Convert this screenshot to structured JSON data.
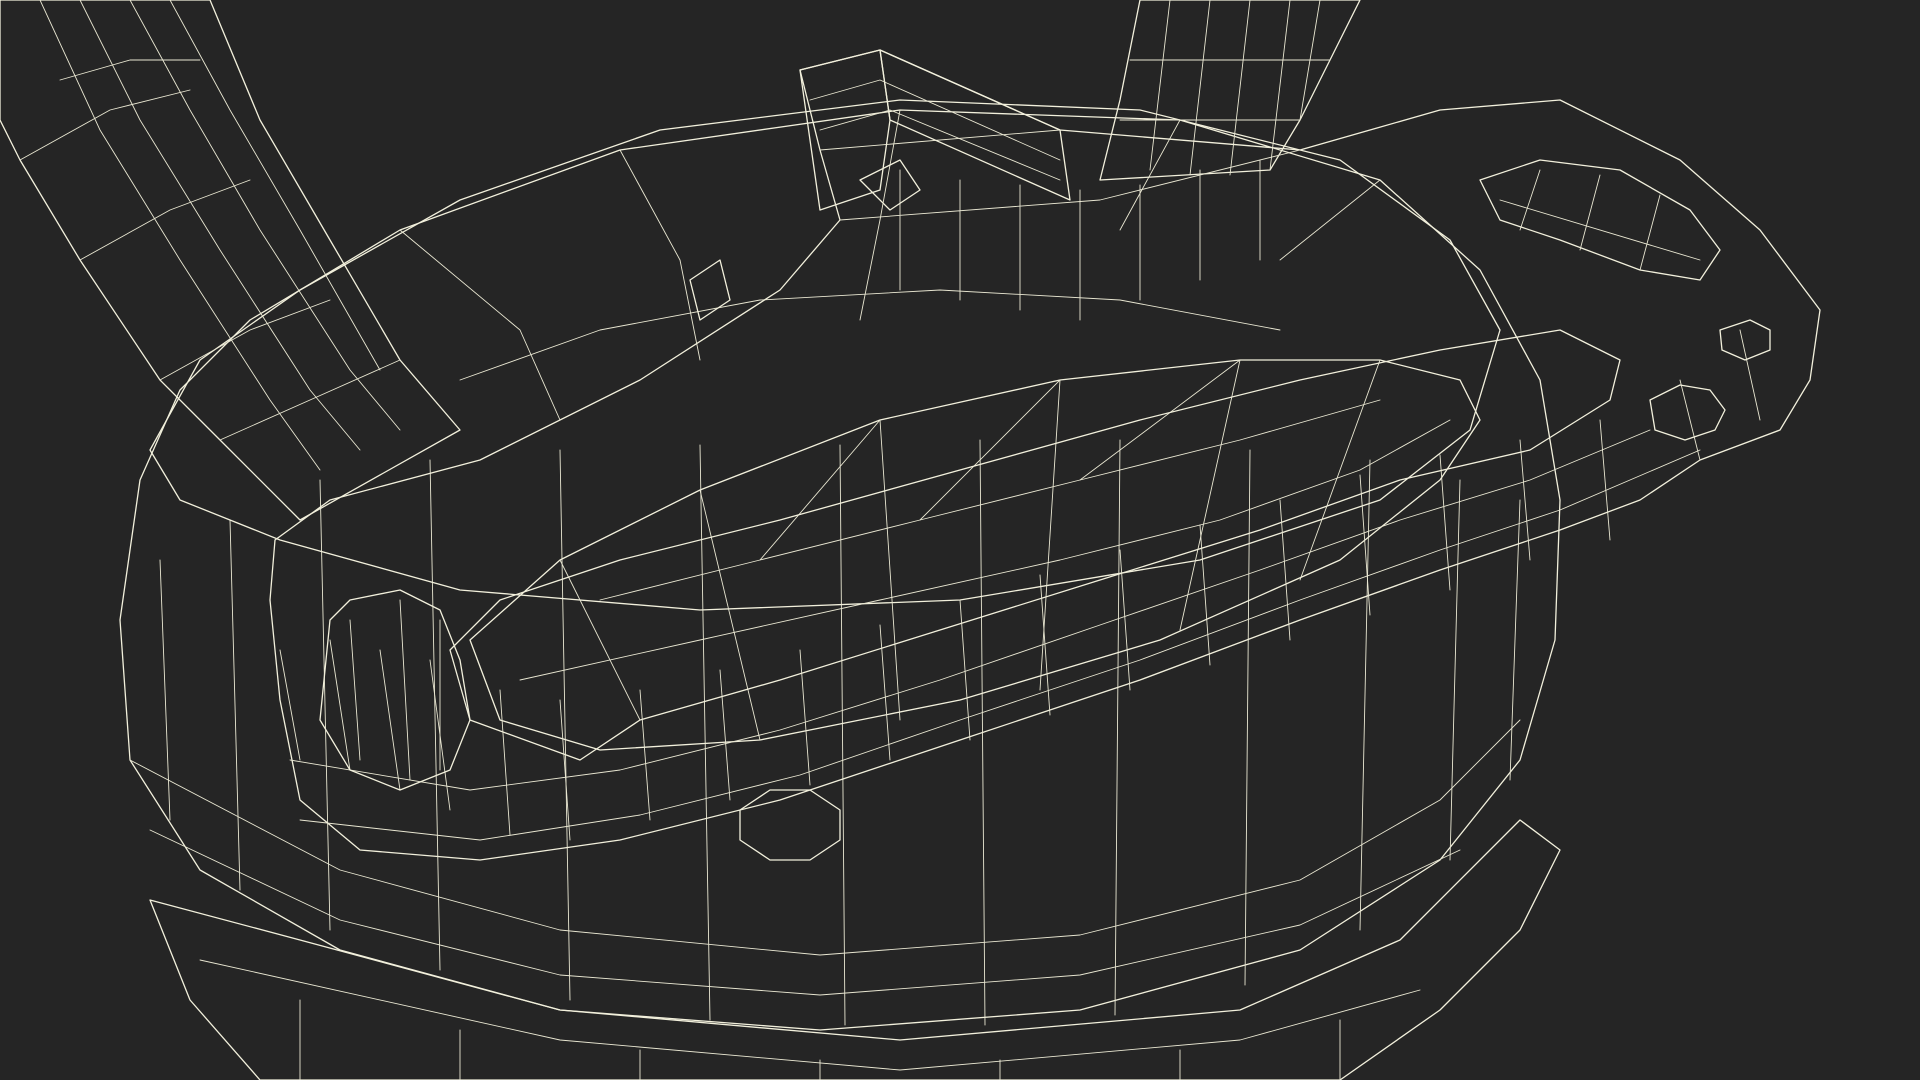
{
  "scene": {
    "background_color": "#252525",
    "mesh_color": "#6f705f",
    "mesh_shadow_color": "#4d4e41",
    "wire_color": "#f2f0dc"
  }
}
